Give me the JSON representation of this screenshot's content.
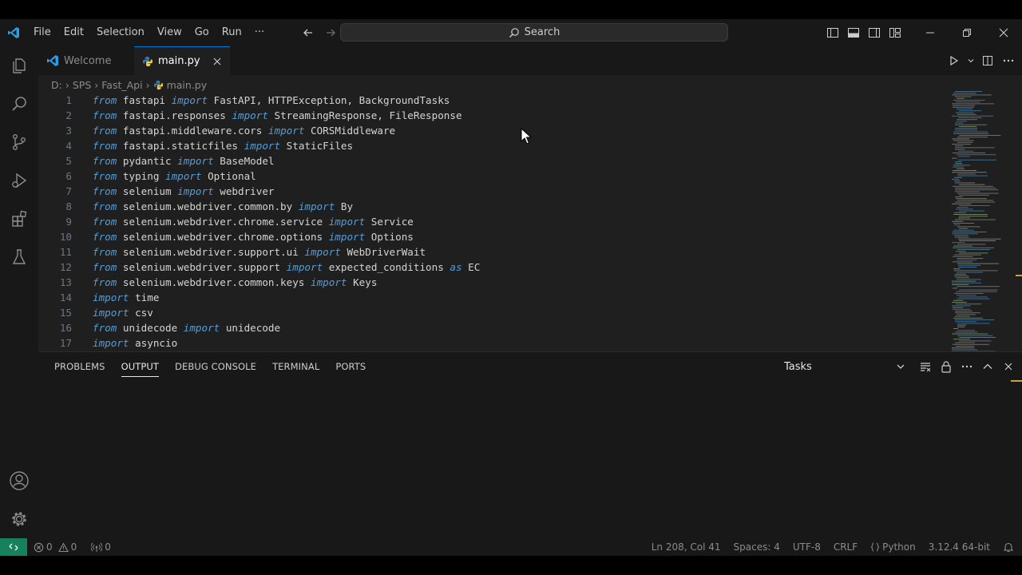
{
  "menu": {
    "items": [
      "File",
      "Edit",
      "Selection",
      "View",
      "Go",
      "Run",
      "···"
    ]
  },
  "search": {
    "label": "Search"
  },
  "tabs": [
    {
      "label": "Welcome",
      "active": false
    },
    {
      "label": "main.py",
      "active": true
    }
  ],
  "breadcrumb": [
    "D:",
    "SPS",
    "Fast_Api",
    "main.py"
  ],
  "code": {
    "lines": [
      {
        "n": "1",
        "t": [
          [
            "kw",
            "from"
          ],
          [
            "tx",
            " fastapi "
          ],
          [
            "kw",
            "import"
          ],
          [
            "tx",
            " FastAPI, HTTPException, BackgroundTasks"
          ]
        ]
      },
      {
        "n": "2",
        "t": [
          [
            "kw",
            "from"
          ],
          [
            "tx",
            " fastapi.responses "
          ],
          [
            "kw",
            "import"
          ],
          [
            "tx",
            " StreamingResponse, FileResponse"
          ]
        ]
      },
      {
        "n": "3",
        "t": [
          [
            "kw",
            "from"
          ],
          [
            "tx",
            " fastapi.middleware.cors "
          ],
          [
            "kw",
            "import"
          ],
          [
            "tx",
            " CORSMiddleware"
          ]
        ]
      },
      {
        "n": "4",
        "t": [
          [
            "kw",
            "from"
          ],
          [
            "tx",
            " fastapi.staticfiles "
          ],
          [
            "kw",
            "import"
          ],
          [
            "tx",
            " StaticFiles"
          ]
        ]
      },
      {
        "n": "5",
        "t": [
          [
            "kw",
            "from"
          ],
          [
            "tx",
            " pydantic "
          ],
          [
            "kw",
            "import"
          ],
          [
            "tx",
            " BaseModel"
          ]
        ]
      },
      {
        "n": "6",
        "t": [
          [
            "kw",
            "from"
          ],
          [
            "tx",
            " typing "
          ],
          [
            "kw",
            "import"
          ],
          [
            "tx",
            " Optional"
          ]
        ]
      },
      {
        "n": "7",
        "t": [
          [
            "kw",
            "from"
          ],
          [
            "tx",
            " selenium "
          ],
          [
            "kw",
            "import"
          ],
          [
            "tx",
            " webdriver"
          ]
        ]
      },
      {
        "n": "8",
        "t": [
          [
            "kw",
            "from"
          ],
          [
            "tx",
            " selenium.webdriver.common.by "
          ],
          [
            "kw",
            "import"
          ],
          [
            "tx",
            " By"
          ]
        ]
      },
      {
        "n": "9",
        "t": [
          [
            "kw",
            "from"
          ],
          [
            "tx",
            " selenium.webdriver.chrome.service "
          ],
          [
            "kw",
            "import"
          ],
          [
            "tx",
            " Service"
          ]
        ]
      },
      {
        "n": "10",
        "t": [
          [
            "kw",
            "from"
          ],
          [
            "tx",
            " selenium.webdriver.chrome.options "
          ],
          [
            "kw",
            "import"
          ],
          [
            "tx",
            " Options"
          ]
        ]
      },
      {
        "n": "11",
        "t": [
          [
            "kw",
            "from"
          ],
          [
            "tx",
            " selenium.webdriver.support.ui "
          ],
          [
            "kw",
            "import"
          ],
          [
            "tx",
            " WebDriverWait"
          ]
        ]
      },
      {
        "n": "12",
        "t": [
          [
            "kw",
            "from"
          ],
          [
            "tx",
            " selenium.webdriver.support "
          ],
          [
            "kw",
            "import"
          ],
          [
            "tx",
            " expected_conditions "
          ],
          [
            "kw",
            "as"
          ],
          [
            "tx",
            " EC"
          ]
        ]
      },
      {
        "n": "13",
        "t": [
          [
            "kw",
            "from"
          ],
          [
            "tx",
            " selenium.webdriver.common.keys "
          ],
          [
            "kw",
            "import"
          ],
          [
            "tx",
            " Keys"
          ]
        ]
      },
      {
        "n": "14",
        "t": [
          [
            "kw",
            "import"
          ],
          [
            "tx",
            " time"
          ]
        ]
      },
      {
        "n": "15",
        "t": [
          [
            "kw",
            "import"
          ],
          [
            "tx",
            " csv"
          ]
        ]
      },
      {
        "n": "16",
        "t": [
          [
            "kw",
            "from"
          ],
          [
            "tx",
            " unidecode "
          ],
          [
            "kw",
            "import"
          ],
          [
            "tx",
            " unidecode"
          ]
        ]
      },
      {
        "n": "17",
        "t": [
          [
            "kw",
            "import"
          ],
          [
            "tx",
            " asyncio"
          ]
        ]
      }
    ]
  },
  "panel": {
    "tabs": [
      "PROBLEMS",
      "OUTPUT",
      "DEBUG CONSOLE",
      "TERMINAL",
      "PORTS"
    ],
    "active_tab": "OUTPUT",
    "select_value": "Tasks"
  },
  "status": {
    "errors": "0",
    "warnings": "0",
    "ports": "0",
    "position": "Ln 208, Col 41",
    "spaces": "Spaces: 4",
    "encoding": "UTF-8",
    "eol": "CRLF",
    "language": "Python",
    "interpreter": "3.12.4 64-bit"
  },
  "colors": {
    "accent": "#0078d4",
    "remote": "#16825d",
    "keyword": "#569cd6"
  }
}
